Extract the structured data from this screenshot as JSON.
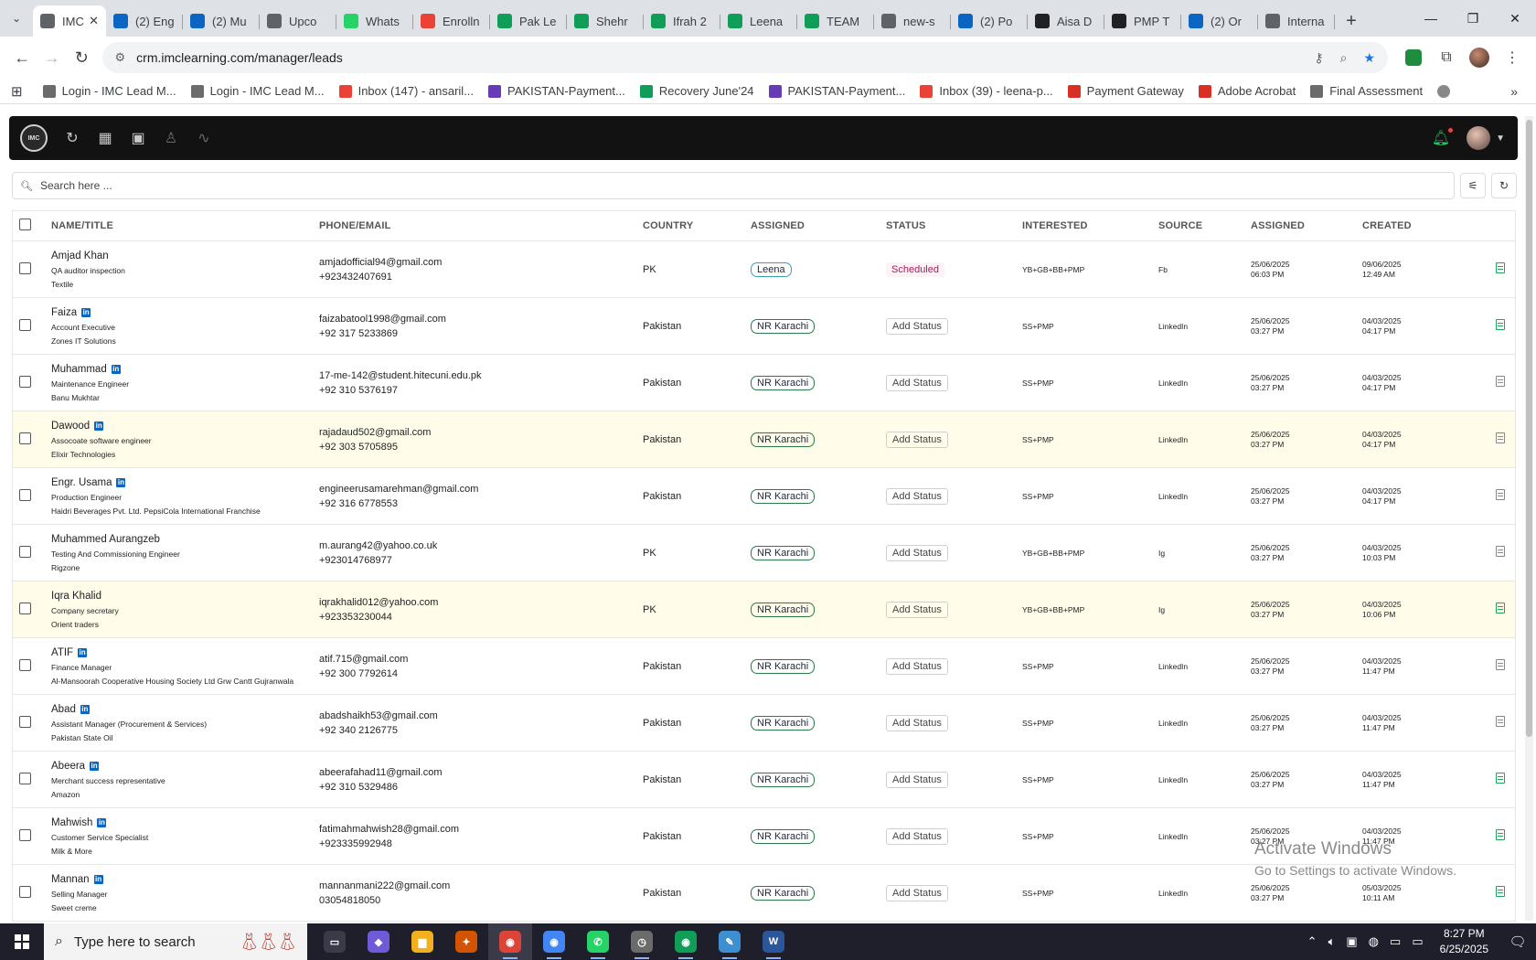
{
  "browser": {
    "tabs": [
      {
        "title": "IMC",
        "favicon": "chrome-icon",
        "color": "#5f6368",
        "active": true
      },
      {
        "title": "(2) Eng",
        "favicon": "linkedin-icon",
        "color": "#0a66c2"
      },
      {
        "title": "(2) Mu",
        "favicon": "linkedin-icon",
        "color": "#0a66c2"
      },
      {
        "title": "Upco",
        "favicon": "chrome-icon",
        "color": "#5f6368"
      },
      {
        "title": "Whats",
        "favicon": "whatsapp-icon",
        "color": "#25d366"
      },
      {
        "title": "Enrolln",
        "favicon": "gmail-icon",
        "color": "#ea4335"
      },
      {
        "title": "Pak Le",
        "favicon": "sheets-icon",
        "color": "#0f9d58"
      },
      {
        "title": "Shehr",
        "favicon": "sheets-icon",
        "color": "#0f9d58"
      },
      {
        "title": "Ifrah 2",
        "favicon": "sheets-icon",
        "color": "#0f9d58"
      },
      {
        "title": "Leena",
        "favicon": "sheets-icon",
        "color": "#0f9d58"
      },
      {
        "title": "TEAM",
        "favicon": "sheets-icon",
        "color": "#0f9d58"
      },
      {
        "title": "new-s",
        "favicon": "chrome-icon",
        "color": "#5f6368"
      },
      {
        "title": "(2) Po",
        "favicon": "linkedin-icon",
        "color": "#0a66c2"
      },
      {
        "title": "Aisa D",
        "favicon": "openai-icon",
        "color": "#202124"
      },
      {
        "title": "PMP T",
        "favicon": "openai-icon",
        "color": "#202124"
      },
      {
        "title": "(2) Or",
        "favicon": "linkedin-icon",
        "color": "#0a66c2"
      },
      {
        "title": "Interna",
        "favicon": "chrome-icon",
        "color": "#5f6368"
      }
    ],
    "url": "crm.imclearning.com/manager/leads",
    "bookmarks": [
      {
        "label": "Login - IMC Lead M...",
        "color": "#6b6b6b"
      },
      {
        "label": "Login - IMC Lead M...",
        "color": "#6b6b6b"
      },
      {
        "label": "Inbox (147) - ansaril...",
        "color": "#ea4335"
      },
      {
        "label": "PAKISTAN-Payment...",
        "color": "#673ab7"
      },
      {
        "label": "Recovery June'24",
        "color": "#0f9d58"
      },
      {
        "label": "PAKISTAN-Payment...",
        "color": "#673ab7"
      },
      {
        "label": "Inbox (39) - leena-p...",
        "color": "#ea4335"
      },
      {
        "label": "Payment Gateway",
        "color": "#d93025"
      },
      {
        "label": "Adobe Acrobat",
        "color": "#d93025"
      },
      {
        "label": "Final Assessment",
        "color": "#6b6b6b"
      }
    ]
  },
  "app": {
    "logo_text": "IMC",
    "search_placeholder": "Search here ...",
    "columns": {
      "name": "NAME/TITLE",
      "phone": "PHONE/EMAIL",
      "country": "COUNTRY",
      "assigned": "ASSIGNED",
      "status": "STATUS",
      "interested": "INTERESTED",
      "source": "SOURCE",
      "assigned_date": "ASSIGNED",
      "created": "CREATED"
    },
    "leads": [
      {
        "name": "Amjad Khan",
        "linkedin": false,
        "title": "QA auditor inspection",
        "company": "Textile",
        "email": "amjadofficial94@gmail.com",
        "phone": "+923432407691",
        "country": "PK",
        "assigned": "Leena",
        "assigned_style": "blue",
        "status": "Scheduled",
        "scheduled": true,
        "interested": "YB+GB+BB+PMP",
        "source": "Fb",
        "assigned_date": "25/06/2025",
        "assigned_time": "06:03 PM",
        "created_date": "09/06/2025",
        "created_time": "12:49 AM",
        "doc_green": true,
        "highlight": false
      },
      {
        "name": "Faiza",
        "linkedin": true,
        "title": "Account Executive",
        "company": "Zones IT Solutions",
        "email": "faizabatool1998@gmail.com",
        "phone": "+92 317 5233869",
        "country": "Pakistan",
        "assigned": "NR Karachi",
        "assigned_style": "green",
        "status": "Add Status",
        "scheduled": false,
        "interested": "SS+PMP",
        "source": "LinkedIn",
        "assigned_date": "25/06/2025",
        "assigned_time": "03:27 PM",
        "created_date": "04/03/2025",
        "created_time": "04:17 PM",
        "doc_green": true,
        "highlight": false
      },
      {
        "name": "Muhammad",
        "linkedin": true,
        "title": "Maintenance Engineer",
        "company": "Banu Mukhtar",
        "email": "17-me-142@student.hitecuni.edu.pk",
        "phone": "+92 310 5376197",
        "country": "Pakistan",
        "assigned": "NR Karachi",
        "assigned_style": "green",
        "status": "Add Status",
        "scheduled": false,
        "interested": "SS+PMP",
        "source": "LinkedIn",
        "assigned_date": "25/06/2025",
        "assigned_time": "03:27 PM",
        "created_date": "04/03/2025",
        "created_time": "04:17 PM",
        "doc_green": false,
        "highlight": false
      },
      {
        "name": "Dawood",
        "linkedin": true,
        "title": "Assocoate software engineer",
        "company": "Elixir Technologies",
        "email": "rajadaud502@gmail.com",
        "phone": "+92 303 5705895",
        "country": "Pakistan",
        "assigned": "NR Karachi",
        "assigned_style": "green",
        "status": "Add Status",
        "scheduled": false,
        "interested": "SS+PMP",
        "source": "LinkedIn",
        "assigned_date": "25/06/2025",
        "assigned_time": "03:27 PM",
        "created_date": "04/03/2025",
        "created_time": "04:17 PM",
        "doc_green": false,
        "highlight": true
      },
      {
        "name": "Engr. Usama",
        "linkedin": true,
        "title": "Production Engineer",
        "company": "Haidri Beverages Pvt. Ltd. PepsiCola International Franchise",
        "email": "engineerusamarehman@gmail.com",
        "phone": "+92 316 6778553",
        "country": "Pakistan",
        "assigned": "NR Karachi",
        "assigned_style": "green",
        "status": "Add Status",
        "scheduled": false,
        "interested": "SS+PMP",
        "source": "LinkedIn",
        "assigned_date": "25/06/2025",
        "assigned_time": "03:27 PM",
        "created_date": "04/03/2025",
        "created_time": "04:17 PM",
        "doc_green": false,
        "highlight": false
      },
      {
        "name": "Muhammed Aurangzeb",
        "linkedin": false,
        "title": "Testing And Commissioning Engineer",
        "company": "Rigzone",
        "email": "m.aurang42@yahoo.co.uk",
        "phone": "+923014768977",
        "country": "PK",
        "assigned": "NR Karachi",
        "assigned_style": "green",
        "status": "Add Status",
        "scheduled": false,
        "interested": "YB+GB+BB+PMP",
        "source": "Ig",
        "assigned_date": "25/06/2025",
        "assigned_time": "03:27 PM",
        "created_date": "04/03/2025",
        "created_time": "10:03 PM",
        "doc_green": false,
        "highlight": false
      },
      {
        "name": "Iqra Khalid",
        "linkedin": false,
        "title": "Company secretary",
        "company": "Orient traders",
        "email": "iqrakhalid012@yahoo.com",
        "phone": "+923353230044",
        "country": "PK",
        "assigned": "NR Karachi",
        "assigned_style": "green",
        "status": "Add Status",
        "scheduled": false,
        "interested": "YB+GB+BB+PMP",
        "source": "Ig",
        "assigned_date": "25/06/2025",
        "assigned_time": "03:27 PM",
        "created_date": "04/03/2025",
        "created_time": "10:06 PM",
        "doc_green": true,
        "highlight": true
      },
      {
        "name": "ATIF",
        "linkedin": true,
        "title": "Finance Manager",
        "company": "Al-Mansoorah Cooperative Housing Society Ltd Grw Cantt Gujranwala",
        "email": "atif.715@gmail.com",
        "phone": "+92 300 7792614",
        "country": "Pakistan",
        "assigned": "NR Karachi",
        "assigned_style": "green",
        "status": "Add Status",
        "scheduled": false,
        "interested": "SS+PMP",
        "source": "LinkedIn",
        "assigned_date": "25/06/2025",
        "assigned_time": "03:27 PM",
        "created_date": "04/03/2025",
        "created_time": "11:47 PM",
        "doc_green": false,
        "highlight": false
      },
      {
        "name": "Abad",
        "linkedin": true,
        "title": "Assistant Manager (Procurement & Services)",
        "company": "Pakistan State Oil",
        "email": "abadshaikh53@gmail.com",
        "phone": "+92 340 2126775",
        "country": "Pakistan",
        "assigned": "NR Karachi",
        "assigned_style": "green",
        "status": "Add Status",
        "scheduled": false,
        "interested": "SS+PMP",
        "source": "LinkedIn",
        "assigned_date": "25/06/2025",
        "assigned_time": "03:27 PM",
        "created_date": "04/03/2025",
        "created_time": "11:47 PM",
        "doc_green": false,
        "highlight": false
      },
      {
        "name": "Abeera",
        "linkedin": true,
        "title": "Merchant success representative",
        "company": "Amazon",
        "email": "abeerafahad11@gmail.com",
        "phone": "+92 310 5329486",
        "country": "Pakistan",
        "assigned": "NR Karachi",
        "assigned_style": "green",
        "status": "Add Status",
        "scheduled": false,
        "interested": "SS+PMP",
        "source": "LinkedIn",
        "assigned_date": "25/06/2025",
        "assigned_time": "03:27 PM",
        "created_date": "04/03/2025",
        "created_time": "11:47 PM",
        "doc_green": true,
        "highlight": false
      },
      {
        "name": "Mahwish",
        "linkedin": true,
        "title": "Customer Service Specialist",
        "company": "Milk & More",
        "email": "fatimahmahwish28@gmail.com",
        "phone": "+923335992948",
        "country": "Pakistan",
        "assigned": "NR Karachi",
        "assigned_style": "green",
        "status": "Add Status",
        "scheduled": false,
        "interested": "SS+PMP",
        "source": "LinkedIn",
        "assigned_date": "25/06/2025",
        "assigned_time": "03:27 PM",
        "created_date": "04/03/2025",
        "created_time": "11:47 PM",
        "doc_green": true,
        "highlight": false
      },
      {
        "name": "Mannan",
        "linkedin": true,
        "title": "Selling Manager",
        "company": "Sweet creme",
        "email": "mannanmani222@gmail.com",
        "phone": "03054818050",
        "country": "Pakistan",
        "assigned": "NR Karachi",
        "assigned_style": "green",
        "status": "Add Status",
        "scheduled": false,
        "interested": "SS+PMP",
        "source": "LinkedIn",
        "assigned_date": "25/06/2025",
        "assigned_time": "03:27 PM",
        "created_date": "05/03/2025",
        "created_time": "10:11 AM",
        "doc_green": true,
        "highlight": false
      }
    ]
  },
  "watermark": {
    "line1": "Activate Windows",
    "line2": "Go to Settings to activate Windows."
  },
  "taskbar": {
    "search_placeholder": "Type here to search",
    "time": "8:27 PM",
    "date": "6/25/2025",
    "apps": [
      {
        "name": "task-view-icon",
        "color": "#3a3a48",
        "glyph": "▭"
      },
      {
        "name": "copilot-icon",
        "color": "#6f5bd8",
        "glyph": "◆"
      },
      {
        "name": "file-explorer-icon",
        "color": "#f2b01e",
        "glyph": "▆"
      },
      {
        "name": "app-icon",
        "color": "#d35400",
        "glyph": "✦"
      },
      {
        "name": "chrome-icon",
        "color": "#db4437",
        "glyph": "◉"
      },
      {
        "name": "chrome-icon",
        "color": "#4285f4",
        "glyph": "◉"
      },
      {
        "name": "whatsapp-icon",
        "color": "#25d366",
        "glyph": "✆"
      },
      {
        "name": "clock-app-icon",
        "color": "#6b6b6b",
        "glyph": "◷"
      },
      {
        "name": "chrome-icon",
        "color": "#0f9d58",
        "glyph": "◉"
      },
      {
        "name": "notepad-icon",
        "color": "#3d8fd1",
        "glyph": "✎"
      },
      {
        "name": "word-icon",
        "color": "#2b579a",
        "glyph": "W"
      }
    ]
  }
}
